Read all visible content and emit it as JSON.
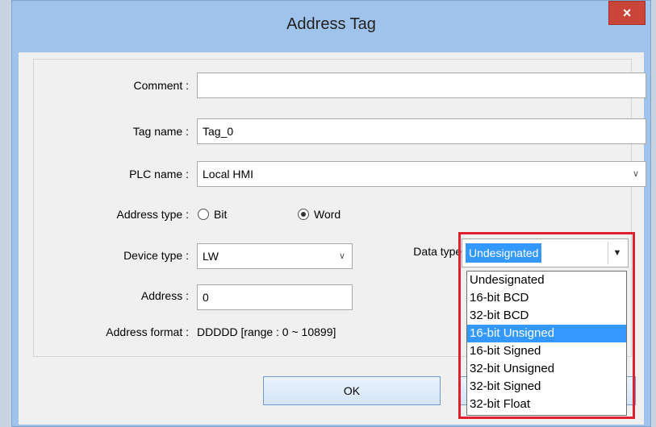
{
  "window": {
    "title": "Address Tag",
    "close_label": "×"
  },
  "fields": {
    "comment": {
      "label": "Comment :",
      "value": ""
    },
    "tag_name": {
      "label": "Tag name :",
      "value": "Tag_0"
    },
    "plc_name": {
      "label": "PLC name :",
      "value": "Local HMI"
    },
    "address_type": {
      "label": "Address type :",
      "options": [
        "Bit",
        "Word"
      ],
      "selected": "Word"
    },
    "device_type": {
      "label": "Device type :",
      "value": "LW"
    },
    "data_type": {
      "label": "Data type :",
      "value": "Undesignated",
      "options": [
        "Undesignated",
        "16-bit BCD",
        "32-bit BCD",
        "16-bit Unsigned",
        "16-bit Signed",
        "32-bit Unsigned",
        "32-bit Signed",
        "32-bit Float"
      ],
      "highlighted": "16-bit Unsigned"
    },
    "address": {
      "label": "Address :",
      "value": "0"
    },
    "address_format": {
      "label": "Address format :",
      "value": "DDDDD [range : 0 ~ 10899]"
    }
  },
  "buttons": {
    "ok": "OK"
  },
  "colors": {
    "highlight": "#3399ff",
    "callout": "#e0202a",
    "close": "#c9453a"
  }
}
